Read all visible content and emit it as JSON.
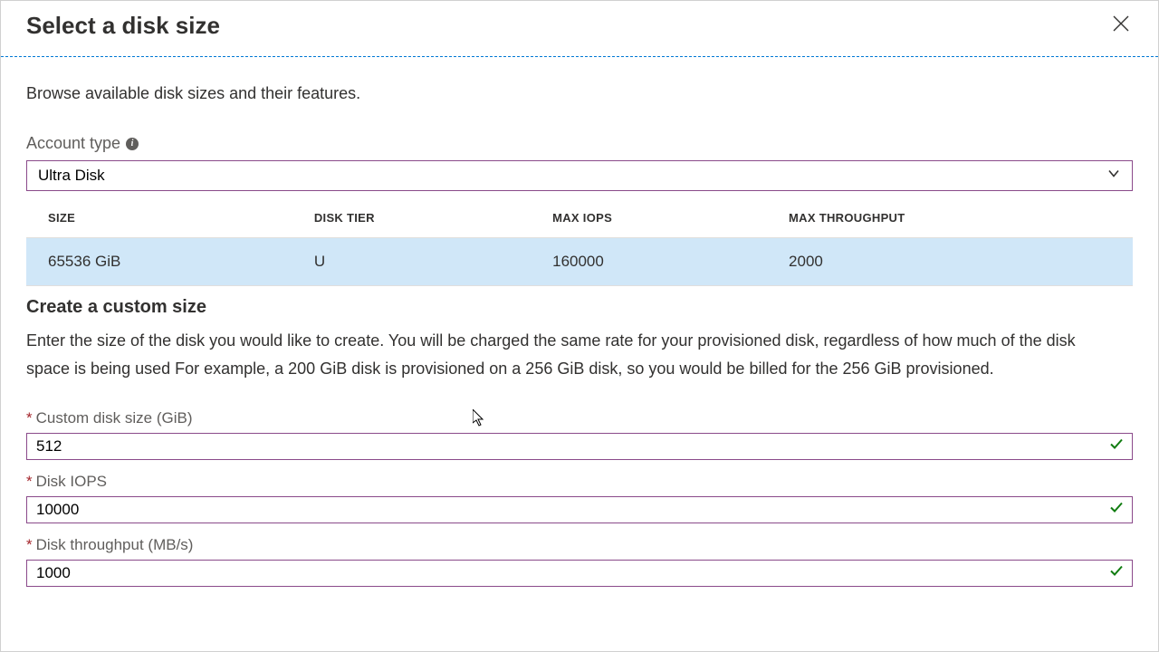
{
  "header": {
    "title": "Select a disk size"
  },
  "intro": "Browse available disk sizes and their features.",
  "accountType": {
    "label": "Account type",
    "value": "Ultra Disk"
  },
  "table": {
    "headers": {
      "size": "SIZE",
      "tier": "DISK TIER",
      "iops": "MAX IOPS",
      "throughput": "MAX THROUGHPUT"
    },
    "rows": [
      {
        "size": "65536 GiB",
        "tier": "U",
        "iops": "160000",
        "throughput": "2000"
      }
    ]
  },
  "customSection": {
    "title": "Create a custom size",
    "body": "Enter the size of the disk you would like to create. You will be charged the same rate for your provisioned disk, regardless of how much of the disk space is being used For example, a 200 GiB disk is provisioned on a 256 GiB disk, so you would be billed for the 256 GiB provisioned."
  },
  "fields": {
    "customSize": {
      "label": "Custom disk size (GiB)",
      "value": "512"
    },
    "diskIops": {
      "label": "Disk IOPS",
      "value": "10000"
    },
    "diskThroughput": {
      "label": "Disk throughput (MB/s)",
      "value": "1000"
    }
  }
}
